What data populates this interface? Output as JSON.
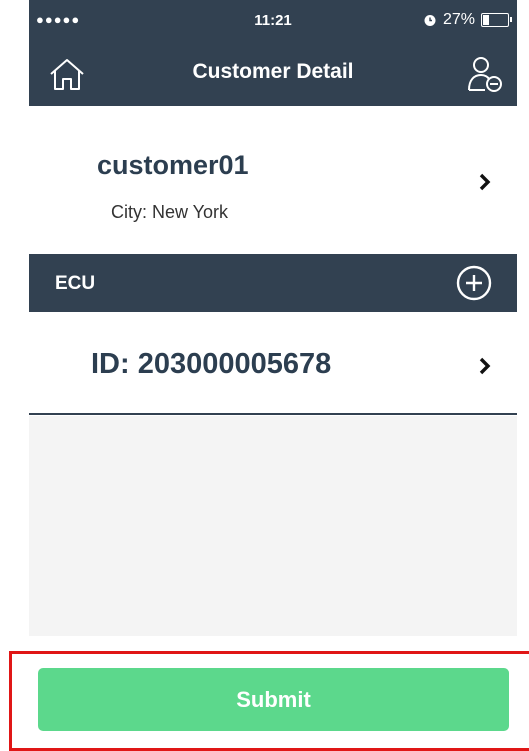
{
  "status_bar": {
    "signal": "●●●●●",
    "time": "11:21",
    "battery": "27%",
    "battery_level": 0.27
  },
  "nav": {
    "title": "Customer Detail",
    "left_icon": "home-icon",
    "right_icon": "user-remove-icon"
  },
  "customer": {
    "name": "customer01",
    "city": "City:  New York"
  },
  "section": {
    "label": "ECU",
    "add_icon": "add-circle-icon"
  },
  "ecu": {
    "id": "ID:  203000005678"
  },
  "footer": {
    "submit_label": "Submit"
  },
  "colors": {
    "header": "#324151",
    "submit": "#5cd88c",
    "highlight": "#e01616"
  }
}
